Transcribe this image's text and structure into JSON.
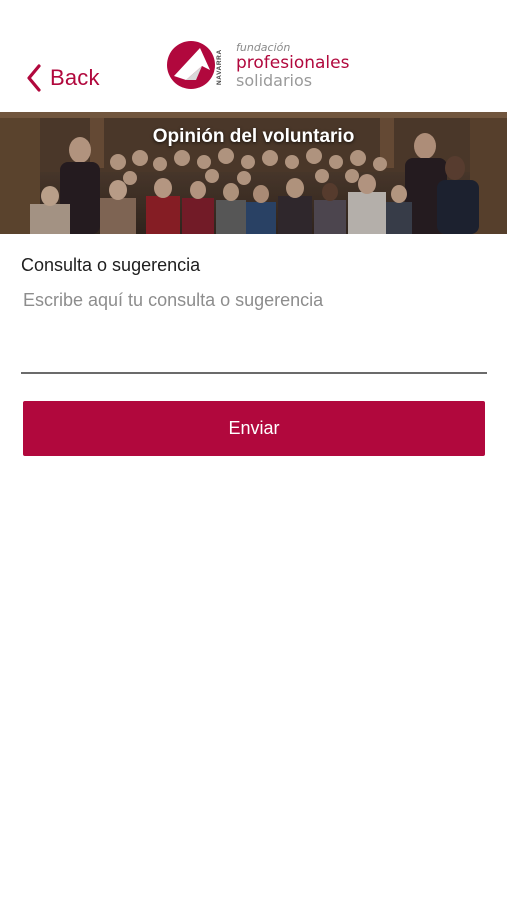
{
  "nav": {
    "back_label": "Back"
  },
  "logo": {
    "side_text": "NAVARRA",
    "line1": "fundación",
    "line2": "profesionales",
    "line3": "solidarios"
  },
  "banner": {
    "title": "Opinión del voluntario"
  },
  "form": {
    "label": "Consulta o sugerencia",
    "placeholder": "Escribe aquí tu consulta o sugerencia",
    "value": "",
    "submit_label": "Enviar"
  },
  "colors": {
    "accent": "#b1083d",
    "underline": "#6b6b6b",
    "placeholder": "#8d8d8d"
  },
  "icons": {
    "back": "chevron-left-icon"
  }
}
